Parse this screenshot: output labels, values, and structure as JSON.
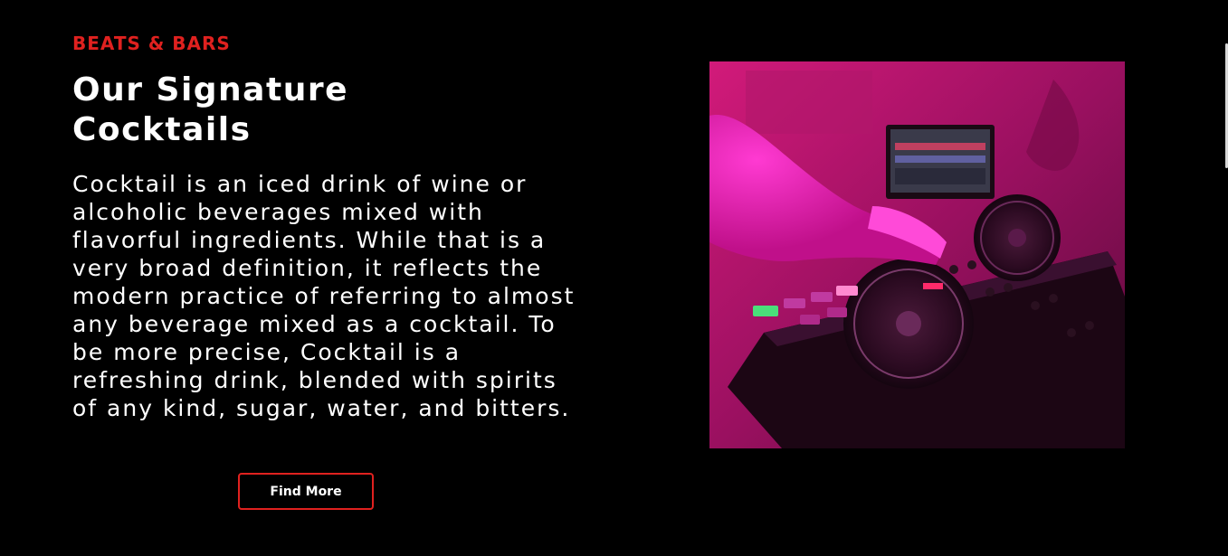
{
  "section": {
    "eyebrow": "BEATS & BARS",
    "title": "Our Signature Cocktails",
    "body": "Cocktail is an iced drink of wine or alcoholic beverages mixed with flavorful ingredients. While that is a very broad definition, it reflects the modern practice of referring to almost any beverage mixed as a cocktail. To be more precise, Cocktail is a refreshing drink, blended with spirits of any kind, sugar, water, and bitters.",
    "cta_label": "Find More"
  },
  "colors": {
    "background": "#000000",
    "accent": "#e0211f",
    "text": "#ffffff"
  }
}
